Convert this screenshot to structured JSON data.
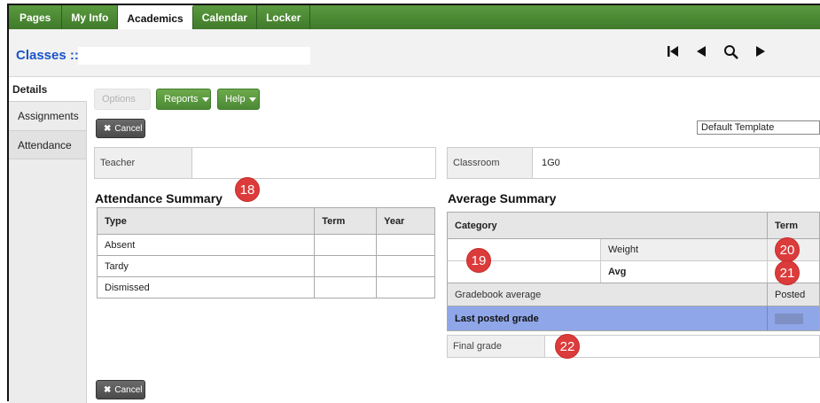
{
  "nav": {
    "tabs": [
      {
        "label": "Pages"
      },
      {
        "label": "My Info"
      },
      {
        "label": "Academics",
        "active": true
      },
      {
        "label": "Calendar"
      },
      {
        "label": "Locker"
      }
    ]
  },
  "classbar": {
    "title": "Classes ::",
    "controls": [
      "first-page-icon",
      "previous-icon",
      "search-icon",
      "next-icon"
    ]
  },
  "sidebar": {
    "items": [
      {
        "label": "Details"
      },
      {
        "label": "Assignments"
      },
      {
        "label": "Attendance"
      }
    ]
  },
  "toolbar": {
    "options_label": "Options",
    "reports_label": "Reports",
    "help_label": "Help",
    "cancel_label": "Cancel",
    "template_value": "Default Template"
  },
  "info": {
    "teacher_label": "Teacher",
    "teacher_value": "",
    "classroom_label": "Classroom",
    "classroom_value": "1G0"
  },
  "attendance": {
    "title": "Attendance Summary",
    "headers": [
      "Type",
      "Term",
      "Year"
    ],
    "rows": [
      "Absent",
      "Tardy",
      "Dismissed"
    ]
  },
  "average": {
    "title": "Average Summary",
    "category_header": "Category",
    "term_header": "Term",
    "weight_label": "Weight",
    "avg_label": "Avg",
    "gradebook_label": "Gradebook average",
    "posted_label": "Posted",
    "last_posted_label": "Last posted grade",
    "final_grade_label": "Final grade"
  },
  "badges": {
    "b18": "18",
    "b19": "19",
    "b20": "20",
    "b21": "21",
    "b22": "22"
  },
  "colors": {
    "nav_green": "#4a8a34",
    "title_blue": "#1a54c8",
    "highlight_row": "#8fa6e8",
    "badge_red": "#dc3b3b"
  }
}
